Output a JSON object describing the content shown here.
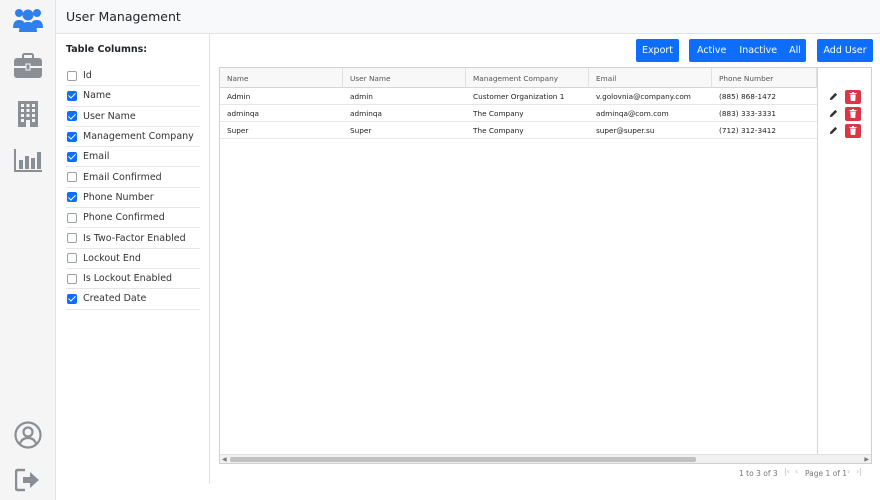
{
  "header": {
    "title": "User Management"
  },
  "nav": {
    "items": [
      {
        "icon": "users-icon",
        "active": true
      },
      {
        "icon": "briefcase-icon",
        "active": false
      },
      {
        "icon": "building-icon",
        "active": false
      },
      {
        "icon": "bar-chart-icon",
        "active": false
      }
    ],
    "bottom": [
      {
        "icon": "user-profile-icon"
      },
      {
        "icon": "sign-out-icon"
      }
    ]
  },
  "columns_panel": {
    "title": "Table Columns:",
    "items": [
      {
        "label": "Id",
        "checked": false
      },
      {
        "label": "Name",
        "checked": true
      },
      {
        "label": "User Name",
        "checked": true
      },
      {
        "label": "Management Company",
        "checked": true
      },
      {
        "label": "Email",
        "checked": true
      },
      {
        "label": "Email Confirmed",
        "checked": false
      },
      {
        "label": "Phone Number",
        "checked": true
      },
      {
        "label": "Phone Confirmed",
        "checked": false
      },
      {
        "label": "Is Two-Factor Enabled",
        "checked": false
      },
      {
        "label": "Lockout End",
        "checked": false
      },
      {
        "label": "Is Lockout Enabled",
        "checked": false
      },
      {
        "label": "Created Date",
        "checked": true
      }
    ]
  },
  "toolbar": {
    "export_label": "Export",
    "filter_active": "Active",
    "filter_inactive": "Inactive",
    "filter_all": "All",
    "add_label": "Add User"
  },
  "table": {
    "headers": [
      "Name",
      "User Name",
      "Management Company",
      "Email",
      "Phone Number"
    ],
    "rows": [
      [
        "Admin",
        "admin",
        "Customer Organization 1",
        "v.golovnia@company.com",
        "(885) 868-1472"
      ],
      [
        "adminqa",
        "adminqa",
        "The Company",
        "adminqa@com.com",
        "(883) 333-3331"
      ],
      [
        "Super",
        "Super",
        "The Company",
        "super@super.su",
        "(712) 312-3412"
      ]
    ]
  },
  "pager": {
    "range": "1 to 3 of 3",
    "page": "Page 1 of 1"
  },
  "colors": {
    "primary": "#0d6efd",
    "danger": "#dc3545",
    "nav_active": "#2f80ed",
    "nav_inactive": "#8a8f95"
  }
}
